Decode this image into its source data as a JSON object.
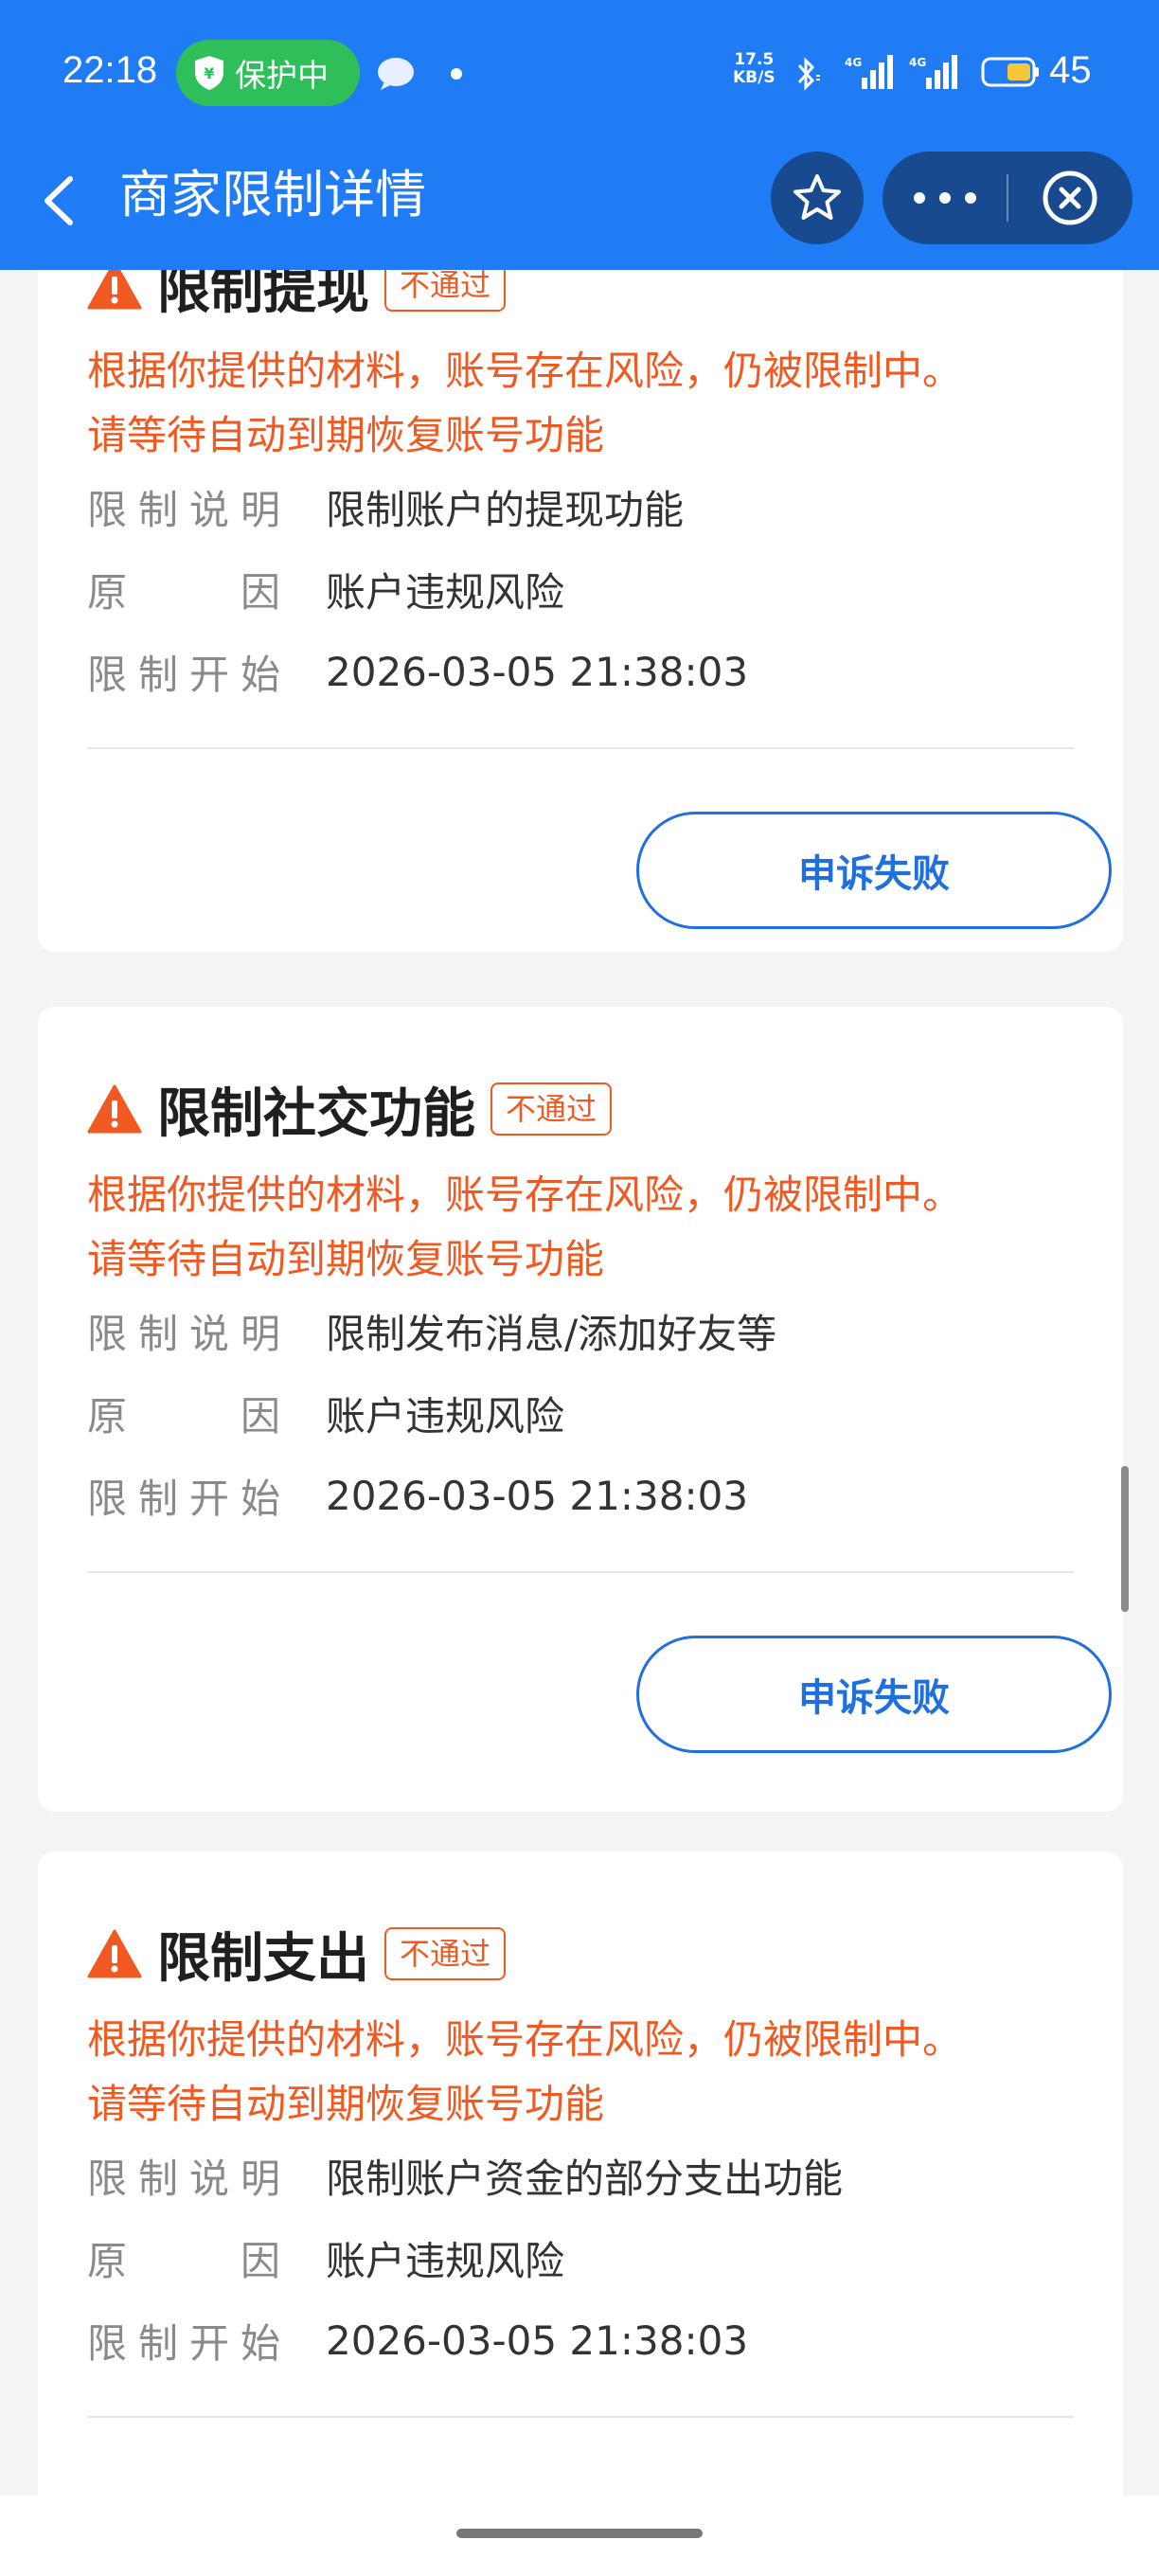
{
  "status_bar": {
    "time": "22:18",
    "protect_label": "保护中",
    "net_speed_value": "17.5",
    "net_speed_unit": "KB/S",
    "signal_1": "4G",
    "signal_2": "4G",
    "battery_level": "45"
  },
  "nav": {
    "title": "商家限制详情"
  },
  "cards": [
    {
      "title": "限制提现",
      "status": "不通过",
      "notice_line1": "根据你提供的材料，账号存在风险，仍被限制中。",
      "notice_line2": "请等待自动到期恢复账号功能",
      "label_desc": [
        "限",
        "制",
        "说",
        "明"
      ],
      "label_reason": [
        "原",
        "因"
      ],
      "label_start": [
        "限",
        "制",
        "开",
        "始"
      ],
      "desc": "限制账户的提现功能",
      "reason": "账户违规风险",
      "start": "2026-03-05 21:38:03",
      "button": "申诉失败"
    },
    {
      "title": "限制社交功能",
      "status": "不通过",
      "notice_line1": "根据你提供的材料，账号存在风险，仍被限制中。",
      "notice_line2": "请等待自动到期恢复账号功能",
      "label_desc": [
        "限",
        "制",
        "说",
        "明"
      ],
      "label_reason": [
        "原",
        "因"
      ],
      "label_start": [
        "限",
        "制",
        "开",
        "始"
      ],
      "desc": "限制发布消息/添加好友等",
      "reason": "账户违规风险",
      "start": "2026-03-05 21:38:03",
      "button": "申诉失败"
    },
    {
      "title": "限制支出",
      "status": "不通过",
      "notice_line1": "根据你提供的材料，账号存在风险，仍被限制中。",
      "notice_line2": "请等待自动到期恢复账号功能",
      "label_desc": [
        "限",
        "制",
        "说",
        "明"
      ],
      "label_reason": [
        "原",
        "因"
      ],
      "label_start": [
        "限",
        "制",
        "开",
        "始"
      ],
      "desc": "限制账户资金的部分支出功能",
      "reason": "账户违规风险",
      "start": "2026-03-05 21:38:03"
    }
  ],
  "colors": {
    "brand_blue": "#1f7cf5",
    "warning_orange": "#f05a22",
    "button_blue": "#1f6fe0",
    "protect_green": "#2fbf5a"
  }
}
